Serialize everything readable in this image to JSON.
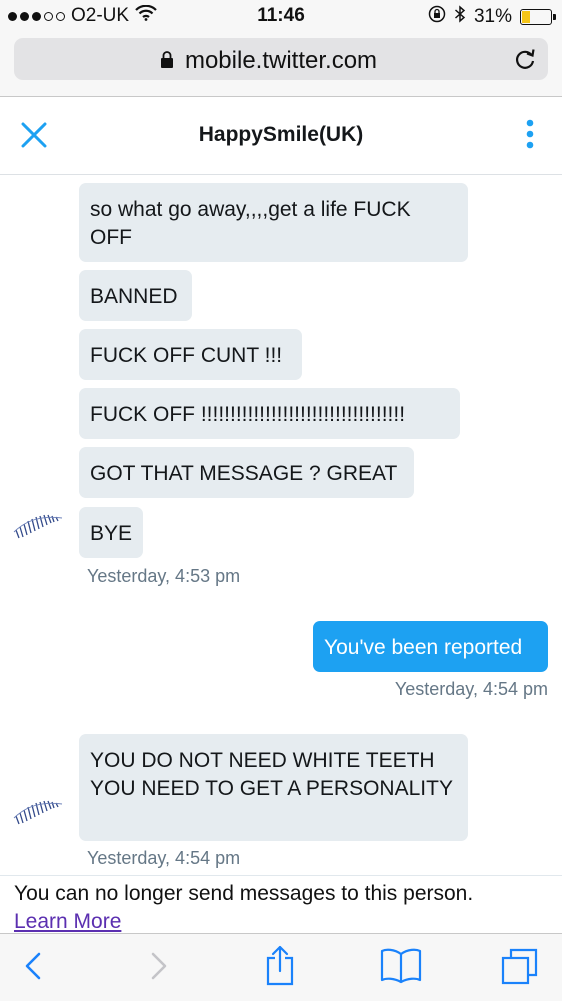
{
  "status_bar": {
    "carrier": "O2-UK",
    "time": "11:46",
    "battery": "31%",
    "battery_level": 0.31
  },
  "browser": {
    "url": "mobile.twitter.com"
  },
  "header": {
    "title": "HappySmile(UK)"
  },
  "messages": [
    {
      "text": "so what go away,,,,get a life  FUCK OFF"
    },
    {
      "text": "BANNED"
    },
    {
      "text": "FUCK OFF CUNT !!!"
    },
    {
      "text": "FUCK OFF !!!!!!!!!!!!!!!!!!!!!!!!!!!!!!!!!!!"
    },
    {
      "text": "GOT THAT MESSAGE ? GREAT"
    },
    {
      "text": "BYE"
    },
    {
      "text": "Yesterday, 4:53 pm"
    },
    {
      "text": "You've been reported"
    },
    {
      "text": "Yesterday, 4:54 pm"
    },
    {
      "text": "YOU DO NOT NEED WHITE TEETH YOU NEED TO  GET A PERSONALITY"
    },
    {
      "text": "Yesterday, 4:54 pm"
    }
  ],
  "footer": {
    "notice": "You can no longer send messages to this person.",
    "link": "Learn More"
  },
  "colors": {
    "tweet_blue": "#1da1f2",
    "bubble_gray": "#e6ecf0",
    "timestamp_gray": "#657786",
    "ios_blue": "#1a82fb"
  },
  "icons": [
    "signal-dots-icon",
    "wifi-icon",
    "orientation-lock-icon",
    "bluetooth-icon",
    "battery-icon",
    "lock-icon",
    "reload-icon",
    "close-icon",
    "more-vertical-icon",
    "back-icon",
    "forward-icon",
    "share-icon",
    "bookmarks-icon",
    "tabs-icon"
  ]
}
